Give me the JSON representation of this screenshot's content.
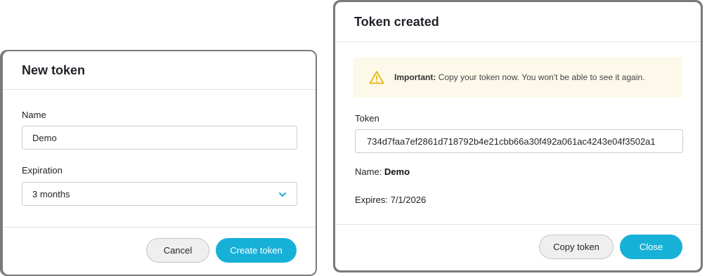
{
  "colors": {
    "primary": "#17b1d8",
    "warning": "#e7b416",
    "alert_bg": "#fdf9ea"
  },
  "new_token_dialog": {
    "title": "New token",
    "name_label": "Name",
    "name_value": "Demo",
    "expiration_label": "Expiration",
    "expiration_value": "3 months",
    "expiration_icon": "chevron-down-icon",
    "cancel_label": "Cancel",
    "create_label": "Create token"
  },
  "token_created_dialog": {
    "title": "Token created",
    "alert_icon": "warning-triangle-icon",
    "alert_strong": "Important:",
    "alert_text": "Copy your token now. You won't be able to see it again.",
    "token_label": "Token",
    "token_value": "734d7faa7ef2861d718792b4e21cbb66a30f492a061ac4243e04f3502a1",
    "name_label": "Name:",
    "name_value": "Demo",
    "expires_label": "Expires:",
    "expires_value": "7/1/2026",
    "copy_label": "Copy token",
    "close_label": "Close"
  }
}
